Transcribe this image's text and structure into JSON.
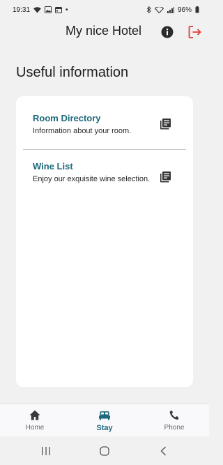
{
  "status_bar": {
    "time": "19:31",
    "battery": "96%",
    "dot": "•"
  },
  "header": {
    "title": "My nice Hotel"
  },
  "page": {
    "title": "Useful information"
  },
  "info_items": [
    {
      "title": "Room Directory",
      "description": "Information about your room."
    },
    {
      "title": "Wine List",
      "description": "Enjoy our exquisite wine selection."
    }
  ],
  "bottom_nav": [
    {
      "label": "Home",
      "icon": "home-icon"
    },
    {
      "label": "Stay",
      "icon": "bed-icon",
      "active": true
    },
    {
      "label": "Phone",
      "icon": "phone-icon"
    }
  ],
  "colors": {
    "accent": "#1e6a7c",
    "logout": "#e53935",
    "background": "#f1f1f1",
    "card": "#ffffff"
  }
}
